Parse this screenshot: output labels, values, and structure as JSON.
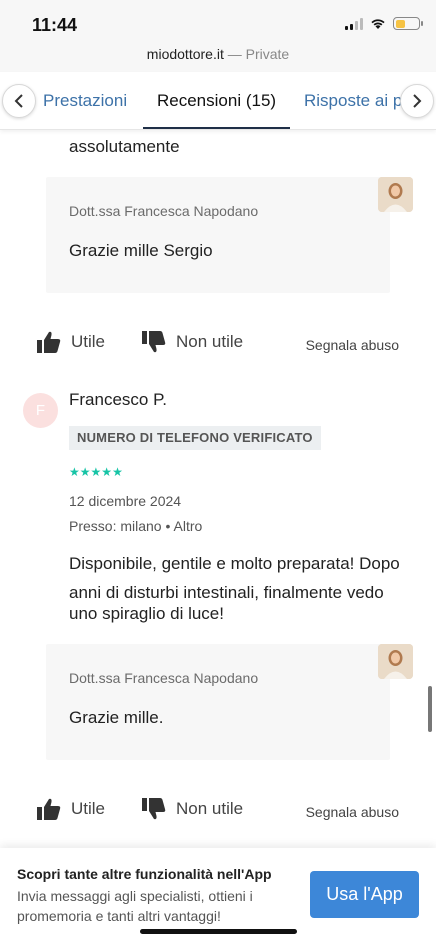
{
  "status_bar": {
    "time": "11:44"
  },
  "browser": {
    "domain": "miodottore.it",
    "mode": " — Private"
  },
  "tabs": [
    {
      "label": "Prestazioni",
      "active": false
    },
    {
      "label": "Recensioni (15)",
      "active": true
    },
    {
      "label": "Risposte ai p",
      "active": false
    }
  ],
  "reviews": {
    "previous": {
      "text_tail": "assolutamente",
      "reply": {
        "author": "Dott.ssa Francesca Napodano",
        "text": "Grazie mille Sergio"
      }
    },
    "current": {
      "avatar_initial": "F",
      "name": "Francesco P.",
      "badge": "NUMERO DI TELEFONO VERIFICATO",
      "rating": 5,
      "date": "12 dicembre 2024",
      "location": "Presso: milano • Altro",
      "text_lines": [
        "Disponibile, gentile e molto preparata! Dopo",
        "anni di disturbi intestinali, finalmente vedo",
        "uno spiraglio di luce!"
      ],
      "reply": {
        "author": "Dott.ssa Francesca Napodano",
        "text": "Grazie mille."
      }
    }
  },
  "actions": {
    "useful": "Utile",
    "not_useful": "Non utile",
    "report": "Segnala abuso"
  },
  "banner": {
    "title": "Scopri tante altre funzionalità nell'App",
    "text": "Invia messaggi agli specialisti, ottieni i promemoria e tanti altri vantaggi!",
    "button": "Usa l'App"
  },
  "colors": {
    "link": "#3d72a8",
    "accent_button": "#3d87d8",
    "stars": "#17c4a6",
    "active_tab_underline": "#1f2f47"
  }
}
